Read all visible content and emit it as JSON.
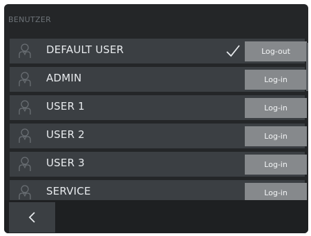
{
  "header": {
    "title": "BENUTZER"
  },
  "users": [
    {
      "name": "DEFAULT USER",
      "action": "Log-out",
      "logged_in": true,
      "icon": "user-icon"
    },
    {
      "name": "ADMIN",
      "action": "Log-in",
      "logged_in": false,
      "icon": "user-icon"
    },
    {
      "name": "USER 1",
      "action": "Log-in",
      "logged_in": false,
      "icon": "user-icon"
    },
    {
      "name": "USER 2",
      "action": "Log-in",
      "logged_in": false,
      "icon": "user-icon"
    },
    {
      "name": "USER 3",
      "action": "Log-in",
      "logged_in": false,
      "icon": "user-icon"
    },
    {
      "name": "SERVICE",
      "action": "Log-in",
      "logged_in": false,
      "icon": "user-icon"
    }
  ],
  "footer": {
    "back_icon": "chevron-left-icon"
  },
  "colors": {
    "background": "#242628",
    "row": "#3b3f43",
    "button": "#86898c",
    "text": "#e8ebee"
  }
}
